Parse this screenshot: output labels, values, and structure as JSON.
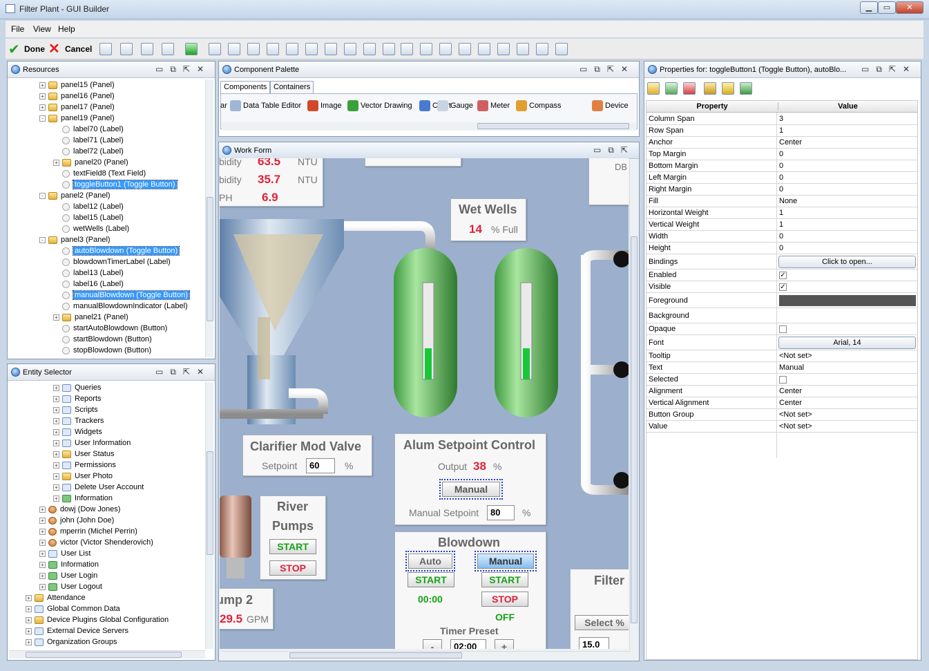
{
  "window": {
    "title": "Filter Plant - GUI Builder"
  },
  "menu": [
    "File",
    "View",
    "Help"
  ],
  "toolbar": {
    "done_label": "Done",
    "cancel_label": "Cancel"
  },
  "resources": {
    "title": "Resources",
    "items": [
      {
        "text": "panel15  (Panel)",
        "indent": 1,
        "type": "folder",
        "exp": "+"
      },
      {
        "text": "panel16  (Panel)",
        "indent": 1,
        "type": "folder",
        "exp": "+"
      },
      {
        "text": "panel17  (Panel)",
        "indent": 1,
        "type": "folder",
        "exp": "+"
      },
      {
        "text": "panel19  (Panel)",
        "indent": 1,
        "type": "folder",
        "exp": "-"
      },
      {
        "text": "label70  (Label)",
        "indent": 2,
        "type": "radio"
      },
      {
        "text": "label71  (Label)",
        "indent": 2,
        "type": "radio"
      },
      {
        "text": "label72  (Label)",
        "indent": 2,
        "type": "radio"
      },
      {
        "text": "panel20  (Panel)",
        "indent": 2,
        "type": "folder",
        "exp": "+"
      },
      {
        "text": "textField8  (Text Field)",
        "indent": 2,
        "type": "radio"
      },
      {
        "text": "toggleButton1  (Toggle Button)",
        "indent": 2,
        "type": "radio",
        "selected": true
      },
      {
        "text": "panel2  (Panel)",
        "indent": 1,
        "type": "folder",
        "exp": "-"
      },
      {
        "text": "label12  (Label)",
        "indent": 2,
        "type": "radio"
      },
      {
        "text": "label15  (Label)",
        "indent": 2,
        "type": "radio"
      },
      {
        "text": "wetWells  (Label)",
        "indent": 2,
        "type": "radio"
      },
      {
        "text": "panel3  (Panel)",
        "indent": 1,
        "type": "folder",
        "exp": "-"
      },
      {
        "text": "autoBlowdown  (Toggle Button)",
        "indent": 2,
        "type": "radio",
        "selected": true
      },
      {
        "text": "blowdownTimerLabel  (Label)",
        "indent": 2,
        "type": "radio"
      },
      {
        "text": "label13  (Label)",
        "indent": 2,
        "type": "radio"
      },
      {
        "text": "label16  (Label)",
        "indent": 2,
        "type": "radio"
      },
      {
        "text": "manualBlowdown  (Toggle Button)",
        "indent": 2,
        "type": "radio",
        "selected": true
      },
      {
        "text": "manualBlowdownIndicator  (Label)",
        "indent": 2,
        "type": "radio"
      },
      {
        "text": "panel21  (Panel)",
        "indent": 2,
        "type": "folder",
        "exp": "+"
      },
      {
        "text": "startAutoBlowdown  (Button)",
        "indent": 2,
        "type": "radio"
      },
      {
        "text": "startBlowdown  (Button)",
        "indent": 2,
        "type": "radio"
      },
      {
        "text": "stopBlowdown  (Button)",
        "indent": 2,
        "type": "radio"
      }
    ]
  },
  "entity_selector": {
    "title": "Entity Selector",
    "items": [
      {
        "text": "Queries",
        "indent": 2,
        "type": "blue",
        "exp": "+"
      },
      {
        "text": "Reports",
        "indent": 2,
        "type": "blue",
        "exp": "+"
      },
      {
        "text": "Scripts",
        "indent": 2,
        "type": "blue",
        "exp": "+"
      },
      {
        "text": "Trackers",
        "indent": 2,
        "type": "blue",
        "exp": "+"
      },
      {
        "text": "Widgets",
        "indent": 2,
        "type": "blue",
        "exp": "+"
      },
      {
        "text": "User Information",
        "indent": 2,
        "type": "blue",
        "exp": "+"
      },
      {
        "text": "User Status",
        "indent": 2,
        "type": "folder",
        "exp": "+"
      },
      {
        "text": "Permissions",
        "indent": 2,
        "type": "blue",
        "exp": "+"
      },
      {
        "text": "User Photo",
        "indent": 2,
        "type": "folder",
        "exp": "+"
      },
      {
        "text": "Delete User Account",
        "indent": 2,
        "type": "blue",
        "exp": "+"
      },
      {
        "text": "Information",
        "indent": 2,
        "type": "green",
        "exp": "+"
      },
      {
        "text": "dowj (Dow Jones)",
        "indent": 1,
        "type": "user",
        "exp": "+"
      },
      {
        "text": "john (John Doe)",
        "indent": 1,
        "type": "user",
        "exp": "+"
      },
      {
        "text": "mperrin (Michel Perrin)",
        "indent": 1,
        "type": "user",
        "exp": "+"
      },
      {
        "text": "victor (Victor Shenderovich)",
        "indent": 1,
        "type": "user",
        "exp": "+"
      },
      {
        "text": "User List",
        "indent": 1,
        "type": "blue",
        "exp": "+"
      },
      {
        "text": "Information",
        "indent": 1,
        "type": "green",
        "exp": "+"
      },
      {
        "text": "User Login",
        "indent": 1,
        "type": "green",
        "exp": "+"
      },
      {
        "text": "User Logout",
        "indent": 1,
        "type": "green",
        "exp": "+"
      },
      {
        "text": "Attendance",
        "indent": 0,
        "type": "folder",
        "exp": "+"
      },
      {
        "text": "Global Common Data",
        "indent": 0,
        "type": "blue",
        "exp": "+"
      },
      {
        "text": "Device Plugins Global Configuration",
        "indent": 0,
        "type": "folder",
        "exp": "+"
      },
      {
        "text": "External Device Servers",
        "indent": 0,
        "type": "blue",
        "exp": "+"
      },
      {
        "text": "Organization Groups",
        "indent": 0,
        "type": "blue",
        "exp": "+"
      }
    ]
  },
  "palette": {
    "title": "Component Palette",
    "tabs": [
      "Components",
      "Containers"
    ],
    "items": [
      "ar",
      "Data Table Editor",
      "Image",
      "Vector Drawing",
      "Chart",
      "Gauge",
      "Meter",
      "Compass",
      "Device"
    ]
  },
  "workform": {
    "title": "Work Form",
    "top_partial": {
      "row1_label": "bidity",
      "row1_value": "63.5",
      "row1_unit": "NTU",
      "row2_label": "bidity",
      "row2_value": "35.7",
      "row2_unit": "NTU",
      "row3_label": "PH",
      "row3_value": "6.9",
      "db": "DB"
    },
    "wet_wells": {
      "title": "Wet Wells",
      "value": "14",
      "unit": "% Full"
    },
    "clarifier": {
      "title": "Clarifier Mod Valve",
      "setpoint_label": "Setpoint",
      "setpoint_value": "60",
      "unit": "%"
    },
    "alum": {
      "title": "Alum Setpoint Control",
      "output_label": "Output",
      "output_value": "38",
      "unit": "%",
      "manual_btn": "Manual",
      "manual_sp_label": "Manual Setpoint",
      "manual_sp_value": "80",
      "unit2": "%"
    },
    "river": {
      "title1": "River",
      "title2": "Pumps",
      "start": "START",
      "stop": "STOP"
    },
    "pump2": {
      "title": "ump 2",
      "value": "29.5",
      "unit": "GPM"
    },
    "blowdown": {
      "title": "Blowdown",
      "auto": "Auto",
      "manual": "Manual",
      "start1": "START",
      "start2": "START",
      "stop": "STOP",
      "time": "00:00",
      "off": "OFF",
      "timer_label": "Timer Preset",
      "minus": "-",
      "timer_value": "02:00",
      "plus": "+"
    },
    "filter": {
      "title": "Filter",
      "select": "Select %",
      "value": "15.0"
    }
  },
  "properties": {
    "title": "Properties for: toggleButton1 (Toggle Button), autoBlo...",
    "col_property": "Property",
    "col_value": "Value",
    "rows": [
      {
        "name": "Column Span",
        "value": "3"
      },
      {
        "name": "Row Span",
        "value": "1"
      },
      {
        "name": "Anchor",
        "value": "Center"
      },
      {
        "name": "Top Margin",
        "value": "0"
      },
      {
        "name": "Bottom Margin",
        "value": "0"
      },
      {
        "name": "Left Margin",
        "value": "0"
      },
      {
        "name": "Right Margin",
        "value": "0"
      },
      {
        "name": "Fill",
        "value": "None"
      },
      {
        "name": "Horizontal Weight",
        "value": "1"
      },
      {
        "name": "Vertical Weight",
        "value": "1"
      },
      {
        "name": "Width",
        "value": "0"
      },
      {
        "name": "Height",
        "value": "0"
      },
      {
        "name": "Bindings",
        "button": "Click to open..."
      },
      {
        "name": "Enabled",
        "check": true
      },
      {
        "name": "Visible",
        "check": true
      },
      {
        "name": "Foreground",
        "color": "#555555"
      },
      {
        "name": "Background",
        "value": ""
      },
      {
        "name": "Opaque",
        "check": false
      },
      {
        "name": "Font",
        "button": "Arial, 14"
      },
      {
        "name": "Tooltip",
        "value": "<Not set>"
      },
      {
        "name": "Text",
        "value": "Manual"
      },
      {
        "name": "Selected",
        "check": false
      },
      {
        "name": "Alignment",
        "value": "Center"
      },
      {
        "name": "Vertical Alignment",
        "value": "Center"
      },
      {
        "name": "Button Group",
        "value": "<Not set>"
      },
      {
        "name": "Value",
        "value": "<Not set>"
      }
    ]
  }
}
